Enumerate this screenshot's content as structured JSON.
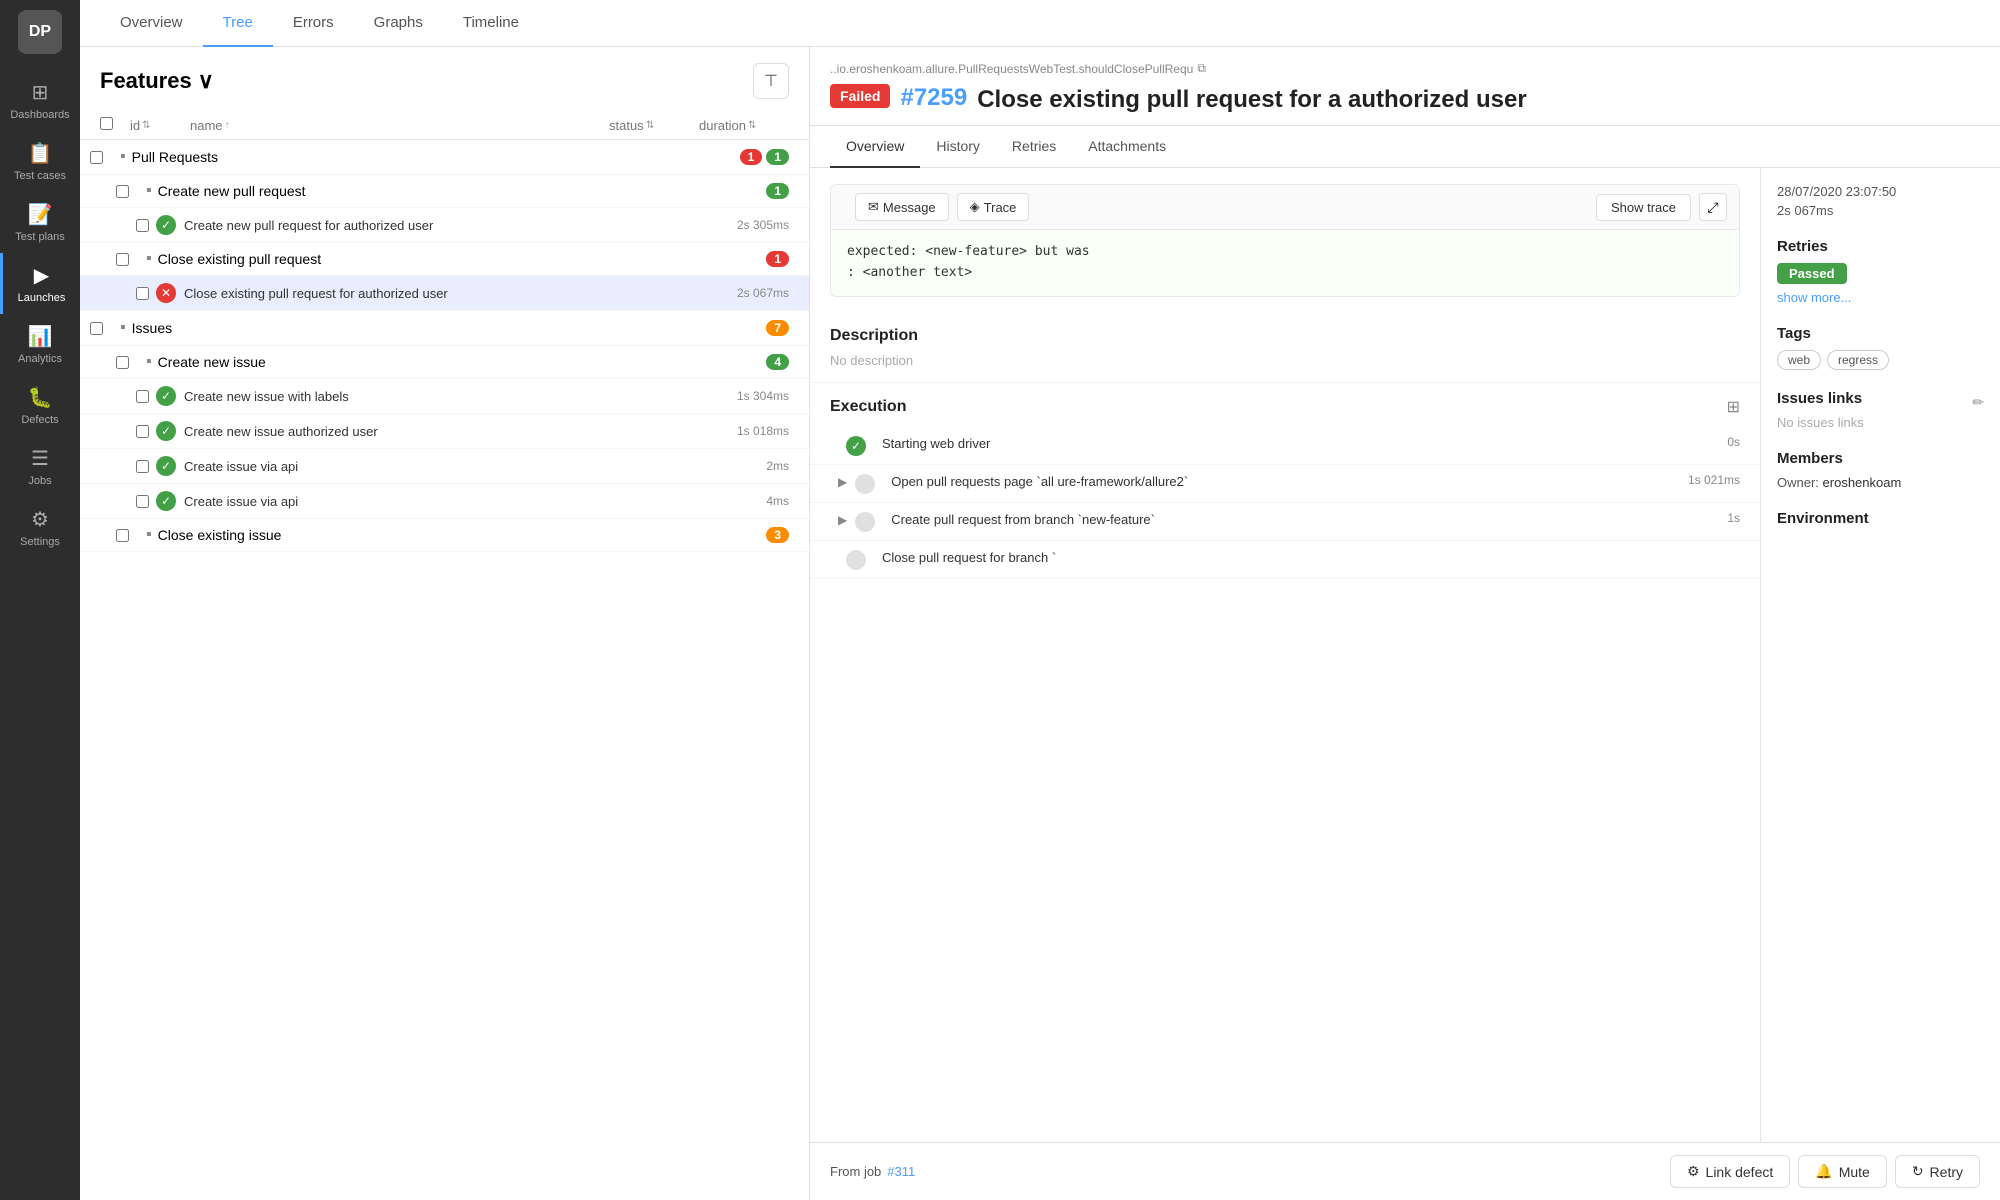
{
  "sidebar": {
    "logo": "DP",
    "items": [
      {
        "id": "dashboards",
        "label": "Dashboards",
        "icon": "⊞",
        "active": false
      },
      {
        "id": "test-cases",
        "label": "Test cases",
        "icon": "📋",
        "active": false
      },
      {
        "id": "test-plans",
        "label": "Test plans",
        "icon": "📝",
        "active": false
      },
      {
        "id": "launches",
        "label": "Launches",
        "icon": "▶",
        "active": true
      },
      {
        "id": "analytics",
        "label": "Analytics",
        "icon": "📊",
        "active": false
      },
      {
        "id": "defects",
        "label": "Defects",
        "icon": "🐛",
        "active": false
      },
      {
        "id": "jobs",
        "label": "Jobs",
        "icon": "☰",
        "active": false
      },
      {
        "id": "settings",
        "label": "Settings",
        "icon": "⚙",
        "active": false
      }
    ]
  },
  "topnav": {
    "tabs": [
      {
        "id": "overview",
        "label": "Overview",
        "active": false
      },
      {
        "id": "tree",
        "label": "Tree",
        "active": true
      },
      {
        "id": "errors",
        "label": "Errors",
        "active": false
      },
      {
        "id": "graphs",
        "label": "Graphs",
        "active": false
      },
      {
        "id": "timeline",
        "label": "Timeline",
        "active": false
      }
    ]
  },
  "left_panel": {
    "features_title": "Features",
    "filter_icon": "⊤",
    "table_headers": {
      "id": "id",
      "name": "name",
      "status": "status",
      "duration": "duration"
    },
    "groups": [
      {
        "id": "pull-requests",
        "name": "Pull Requests",
        "badge_red": "1",
        "badge_green": "1",
        "children": [
          {
            "id": "create-pr",
            "name": "Create new pull request",
            "badge_green": "1",
            "tests": [
              {
                "id": "test-create-pr-auth",
                "name": "Create new pull request for authorized user",
                "status": "pass",
                "duration": "2s 305ms",
                "selected": false
              }
            ]
          },
          {
            "id": "close-pr",
            "name": "Close existing pull request",
            "badge_red": "1",
            "tests": [
              {
                "id": "test-close-pr-auth",
                "name": "Close existing pull request for authorized user",
                "status": "fail",
                "duration": "2s 067ms",
                "selected": true
              }
            ]
          }
        ]
      },
      {
        "id": "issues",
        "name": "Issues",
        "badge_orange": "7",
        "children": [
          {
            "id": "create-issue",
            "name": "Create new issue",
            "badge_green": "4",
            "tests": [
              {
                "id": "test-issue-labels",
                "name": "Create new issue with labels",
                "status": "pass",
                "duration": "1s 304ms",
                "selected": false
              },
              {
                "id": "test-issue-auth",
                "name": "Create new issue authorized user",
                "status": "pass",
                "duration": "1s 018ms",
                "selected": false
              },
              {
                "id": "test-issue-api1",
                "name": "Create issue via api",
                "status": "pass",
                "duration": "2ms",
                "selected": false
              },
              {
                "id": "test-issue-api2",
                "name": "Create issue via api",
                "status": "pass",
                "duration": "4ms",
                "selected": false
              }
            ]
          },
          {
            "id": "close-issue",
            "name": "Close existing issue",
            "badge_orange": "3",
            "tests": []
          }
        ]
      }
    ]
  },
  "right_panel": {
    "path": "..io.eroshenkoam.allure.PullRequestsWebTest.shouldClosePullRequ",
    "status": "Failed",
    "test_id": "#7259",
    "title": "Close existing pull request for a authorized user",
    "tabs": [
      {
        "id": "overview",
        "label": "Overview",
        "active": true
      },
      {
        "id": "history",
        "label": "History",
        "active": false
      },
      {
        "id": "retries",
        "label": "Retries",
        "active": false
      },
      {
        "id": "attachments",
        "label": "Attachments",
        "active": false
      }
    ],
    "trace_buttons": {
      "message": "Message",
      "trace": "Trace",
      "show_trace": "Show trace",
      "expand": "⤢"
    },
    "message_content": "expected: <new-feature> but was\n: <another text>",
    "timestamp": "28/07/2020 23:07:50",
    "duration": "2s 067ms",
    "retries_label": "Retries",
    "retries_status": "Passed",
    "show_more": "show more...",
    "description_title": "Description",
    "description_empty": "No description",
    "execution_title": "Execution",
    "steps": [
      {
        "id": "step-1",
        "text": "Starting web driver",
        "duration": "0s",
        "status": "pass",
        "expandable": false
      },
      {
        "id": "step-2",
        "text": "Open pull requests page `all ure-framework/allure2`",
        "duration": "1s 021ms",
        "status": "neutral",
        "expandable": true
      },
      {
        "id": "step-3",
        "text": "Create pull request from branch `new-feature`",
        "duration": "1s",
        "status": "neutral",
        "expandable": true
      },
      {
        "id": "step-4",
        "text": "Close pull request for branch `",
        "duration": "",
        "status": "neutral",
        "expandable": false
      }
    ],
    "sidebar": {
      "tags_title": "Tags",
      "tags": [
        "web",
        "regress"
      ],
      "issues_links_title": "Issues links",
      "no_issues": "No issues links",
      "members_title": "Members",
      "owner_label": "Owner:",
      "owner_name": "eroshenkoam",
      "environment_title": "Environment"
    },
    "bottom": {
      "from_job_label": "From job",
      "job_id": "#311",
      "link_defect_label": "Link defect",
      "mute_label": "Mute",
      "retry_label": "Retry"
    }
  }
}
